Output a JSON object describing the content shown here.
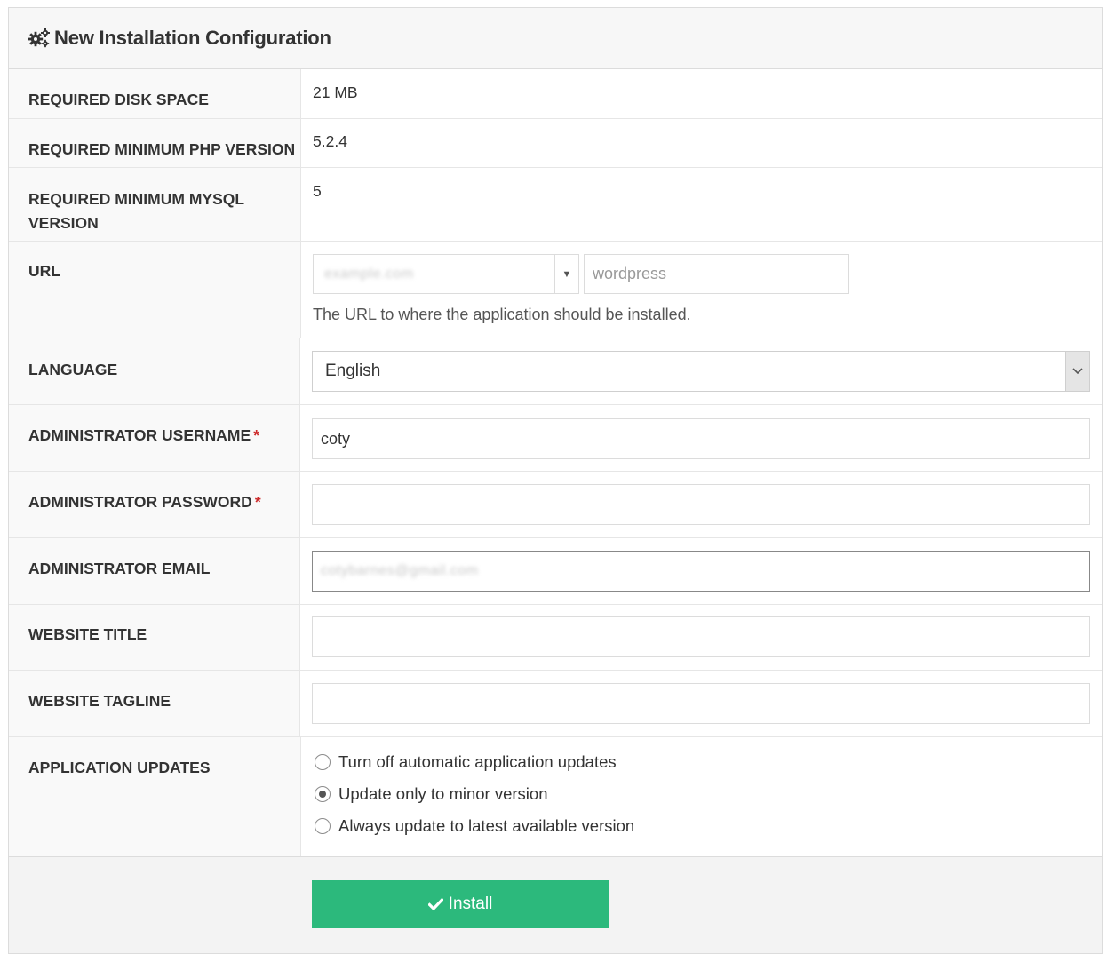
{
  "panel": {
    "title": "New Installation Configuration",
    "icon": "gears-icon"
  },
  "info": {
    "disk_space": {
      "label": "Required Disk Space",
      "value": "21 MB"
    },
    "php_version": {
      "label": "Required Minimum PHP Version",
      "value": "5.2.4"
    },
    "mysql_version": {
      "label": "Required Minimum MySQL Version",
      "value": "5"
    }
  },
  "fields": {
    "url": {
      "label": "URL",
      "domain_value": "example.com",
      "directory_placeholder": "wordpress",
      "help": "The URL to where the application should be installed."
    },
    "language": {
      "label": "Language",
      "value": "English"
    },
    "admin_username": {
      "label": "Administrator Username",
      "value": "coty",
      "required": "*"
    },
    "admin_password": {
      "label": "Administrator Password",
      "value": "",
      "required": "*"
    },
    "admin_email": {
      "label": "Administrator Email",
      "value": "cotybarnes@gmail.com"
    },
    "website_title": {
      "label": "Website Title",
      "value": ""
    },
    "website_tagline": {
      "label": "Website Tagline",
      "value": ""
    },
    "app_updates": {
      "label": "Application Updates",
      "options": [
        {
          "label": "Turn off automatic application updates",
          "checked": false
        },
        {
          "label": "Update only to minor version",
          "checked": true
        },
        {
          "label": "Always update to latest available version",
          "checked": false
        }
      ]
    }
  },
  "footer": {
    "install_label": "Install"
  },
  "colors": {
    "install_button": "#2cb97c",
    "required_marker": "#cc2a2a"
  }
}
